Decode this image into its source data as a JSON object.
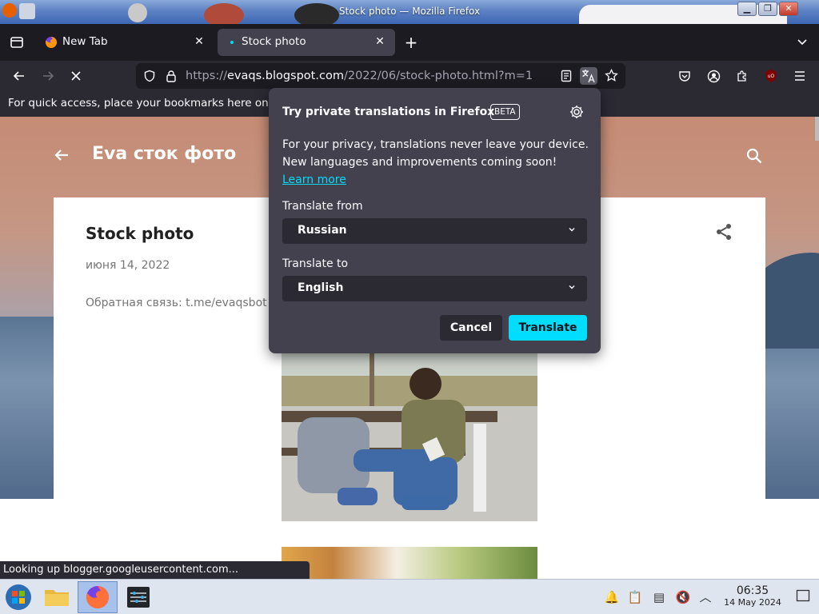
{
  "window": {
    "title": "Stock photo — Mozilla Firefox"
  },
  "tabs": [
    {
      "label": "New Tab",
      "active": false
    },
    {
      "label": "Stock photo",
      "active": true
    }
  ],
  "navbar": {
    "url_scheme": "https://",
    "url_host": "evaqs.blogspot.com",
    "url_path": "/2022/06/stock-photo.html?m=1"
  },
  "bookmarks": {
    "hint": "For quick access, place your bookmarks here on"
  },
  "page": {
    "blog_title": "Eva сток фото",
    "post_title": "Stock photo",
    "post_date": "июня 14, 2022",
    "post_body": "Обратная связь: t.me/evaqsbot"
  },
  "status": {
    "text": "Looking up blogger.googleusercontent.com..."
  },
  "translate_panel": {
    "title": "Try private translations in Firefox",
    "beta": "BETA",
    "desc": "For your privacy, translations never leave your device. New languages and improvements coming soon!",
    "learn_more": "Learn more",
    "from_label": "Translate from",
    "from_value": "Russian",
    "to_label": "Translate to",
    "to_value": "English",
    "cancel": "Cancel",
    "translate": "Translate"
  },
  "taskbar": {
    "time": "06:35",
    "date": "14 May 2024"
  },
  "colors": {
    "accent": "#00ddff",
    "panel": "#42414d",
    "toolbar": "#2b2a33",
    "tabstrip": "#1c1b22"
  }
}
